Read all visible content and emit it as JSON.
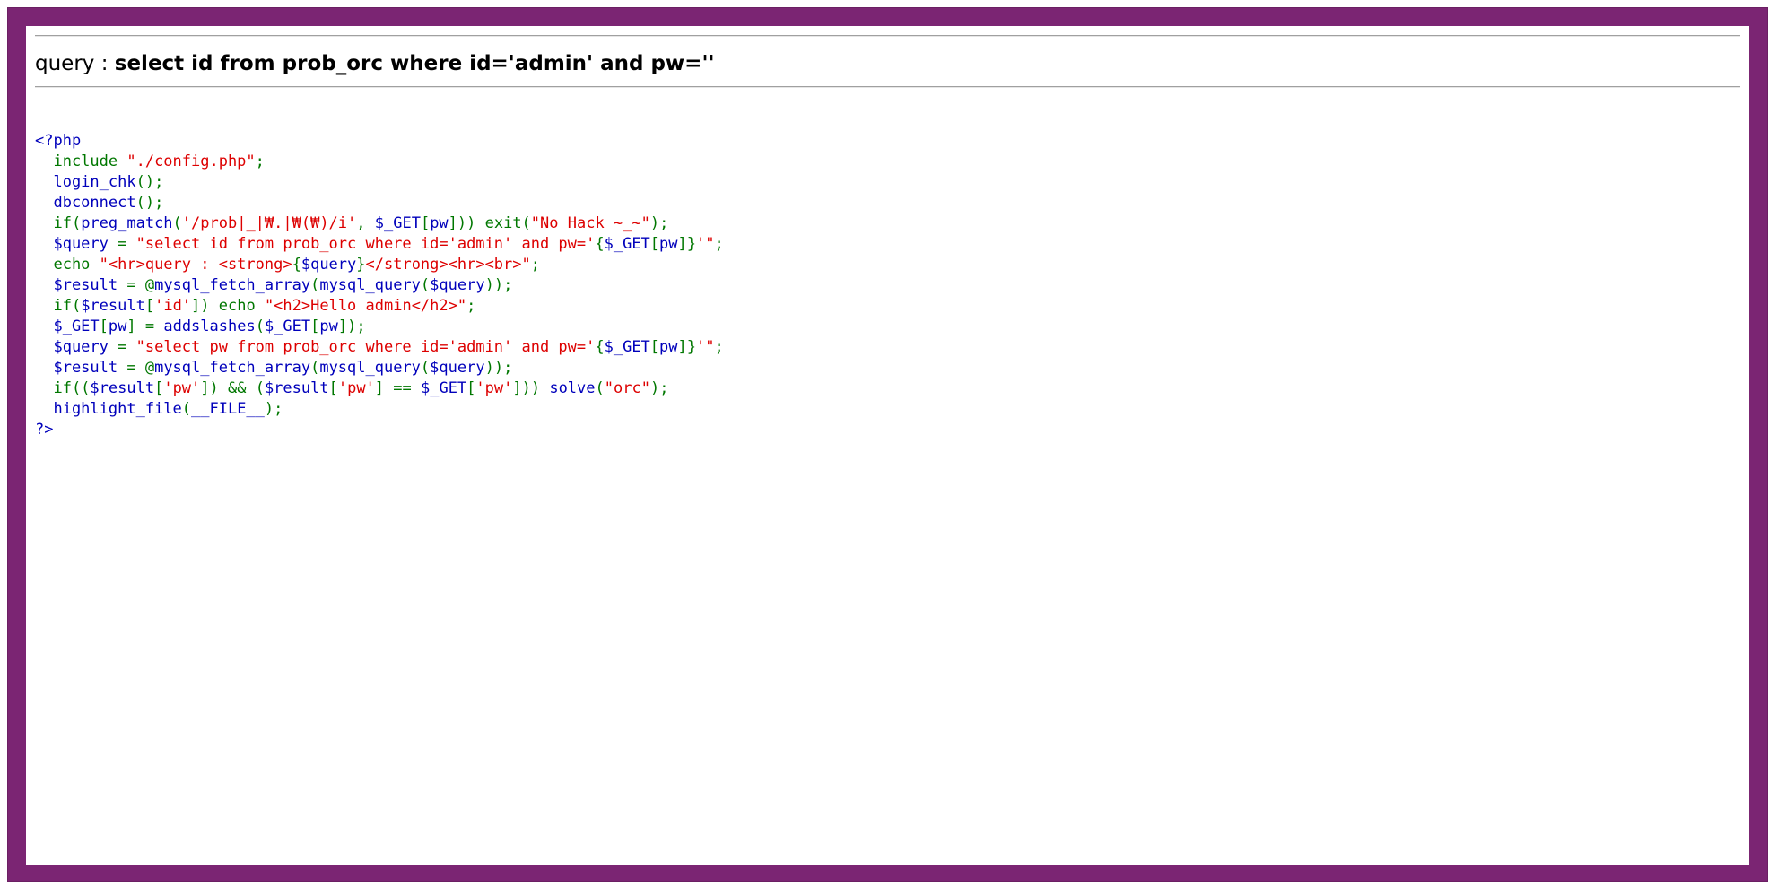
{
  "query_label": "query : ",
  "query_value": "select id from prob_orc where id='admin' and pw=''",
  "code_lines": [
    [
      {
        "t": "php",
        "s": "<?php"
      }
    ],
    [
      {
        "t": "kw",
        "s": "  include "
      },
      {
        "t": "str",
        "s": "\"./config.php\""
      },
      {
        "t": "kw",
        "s": ";"
      }
    ],
    [
      {
        "t": "var",
        "s": "  login_chk"
      },
      {
        "t": "kw",
        "s": "();"
      }
    ],
    [
      {
        "t": "var",
        "s": "  dbconnect"
      },
      {
        "t": "kw",
        "s": "();"
      }
    ],
    [
      {
        "t": "kw",
        "s": "  if("
      },
      {
        "t": "var",
        "s": "preg_match"
      },
      {
        "t": "kw",
        "s": "("
      },
      {
        "t": "str",
        "s": "'/prob|_|₩.|₩(₩)/i'"
      },
      {
        "t": "kw",
        "s": ", "
      },
      {
        "t": "var",
        "s": "$_GET"
      },
      {
        "t": "kw",
        "s": "["
      },
      {
        "t": "var",
        "s": "pw"
      },
      {
        "t": "kw",
        "s": "])) exit("
      },
      {
        "t": "str",
        "s": "\"No Hack ~_~\""
      },
      {
        "t": "kw",
        "s": ");"
      }
    ],
    [
      {
        "t": "var",
        "s": "  $query "
      },
      {
        "t": "kw",
        "s": "= "
      },
      {
        "t": "str",
        "s": "\"select id from prob_orc where id='admin' and pw='"
      },
      {
        "t": "kw",
        "s": "{"
      },
      {
        "t": "var",
        "s": "$_GET"
      },
      {
        "t": "kw",
        "s": "["
      },
      {
        "t": "var",
        "s": "pw"
      },
      {
        "t": "kw",
        "s": "]}"
      },
      {
        "t": "str",
        "s": "'\""
      },
      {
        "t": "kw",
        "s": ";"
      }
    ],
    [
      {
        "t": "kw",
        "s": "  echo "
      },
      {
        "t": "str",
        "s": "\"<hr>query : <strong>"
      },
      {
        "t": "kw",
        "s": "{"
      },
      {
        "t": "var",
        "s": "$query"
      },
      {
        "t": "kw",
        "s": "}"
      },
      {
        "t": "str",
        "s": "</strong><hr><br>\""
      },
      {
        "t": "kw",
        "s": ";"
      }
    ],
    [
      {
        "t": "var",
        "s": "  $result "
      },
      {
        "t": "kw",
        "s": "= @"
      },
      {
        "t": "var",
        "s": "mysql_fetch_array"
      },
      {
        "t": "kw",
        "s": "("
      },
      {
        "t": "var",
        "s": "mysql_query"
      },
      {
        "t": "kw",
        "s": "("
      },
      {
        "t": "var",
        "s": "$query"
      },
      {
        "t": "kw",
        "s": "));"
      }
    ],
    [
      {
        "t": "kw",
        "s": "  if("
      },
      {
        "t": "var",
        "s": "$result"
      },
      {
        "t": "kw",
        "s": "["
      },
      {
        "t": "str",
        "s": "'id'"
      },
      {
        "t": "kw",
        "s": "]) echo "
      },
      {
        "t": "str",
        "s": "\"<h2>Hello admin</h2>\""
      },
      {
        "t": "kw",
        "s": ";"
      }
    ],
    [
      {
        "t": "var",
        "s": "  $_GET"
      },
      {
        "t": "kw",
        "s": "["
      },
      {
        "t": "var",
        "s": "pw"
      },
      {
        "t": "kw",
        "s": "] = "
      },
      {
        "t": "var",
        "s": "addslashes"
      },
      {
        "t": "kw",
        "s": "("
      },
      {
        "t": "var",
        "s": "$_GET"
      },
      {
        "t": "kw",
        "s": "["
      },
      {
        "t": "var",
        "s": "pw"
      },
      {
        "t": "kw",
        "s": "]);"
      }
    ],
    [
      {
        "t": "var",
        "s": "  $query "
      },
      {
        "t": "kw",
        "s": "= "
      },
      {
        "t": "str",
        "s": "\"select pw from prob_orc where id='admin' and pw='"
      },
      {
        "t": "kw",
        "s": "{"
      },
      {
        "t": "var",
        "s": "$_GET"
      },
      {
        "t": "kw",
        "s": "["
      },
      {
        "t": "var",
        "s": "pw"
      },
      {
        "t": "kw",
        "s": "]}"
      },
      {
        "t": "str",
        "s": "'\""
      },
      {
        "t": "kw",
        "s": ";"
      }
    ],
    [
      {
        "t": "var",
        "s": "  $result "
      },
      {
        "t": "kw",
        "s": "= @"
      },
      {
        "t": "var",
        "s": "mysql_fetch_array"
      },
      {
        "t": "kw",
        "s": "("
      },
      {
        "t": "var",
        "s": "mysql_query"
      },
      {
        "t": "kw",
        "s": "("
      },
      {
        "t": "var",
        "s": "$query"
      },
      {
        "t": "kw",
        "s": "));"
      }
    ],
    [
      {
        "t": "kw",
        "s": "  if(("
      },
      {
        "t": "var",
        "s": "$result"
      },
      {
        "t": "kw",
        "s": "["
      },
      {
        "t": "str",
        "s": "'pw'"
      },
      {
        "t": "kw",
        "s": "]) && ("
      },
      {
        "t": "var",
        "s": "$result"
      },
      {
        "t": "kw",
        "s": "["
      },
      {
        "t": "str",
        "s": "'pw'"
      },
      {
        "t": "kw",
        "s": "] == "
      },
      {
        "t": "var",
        "s": "$_GET"
      },
      {
        "t": "kw",
        "s": "["
      },
      {
        "t": "str",
        "s": "'pw'"
      },
      {
        "t": "kw",
        "s": "])) "
      },
      {
        "t": "var",
        "s": "solve"
      },
      {
        "t": "kw",
        "s": "("
      },
      {
        "t": "str",
        "s": "\"orc\""
      },
      {
        "t": "kw",
        "s": ");"
      }
    ],
    [
      {
        "t": "var",
        "s": "  highlight_file"
      },
      {
        "t": "kw",
        "s": "("
      },
      {
        "t": "var",
        "s": "__FILE__"
      },
      {
        "t": "kw",
        "s": ");"
      }
    ],
    [
      {
        "t": "php",
        "s": "?>"
      }
    ]
  ],
  "colors": {
    "frame": "#7b2573",
    "keyword": "#007700",
    "string": "#dd0000",
    "default": "#0000bb"
  }
}
